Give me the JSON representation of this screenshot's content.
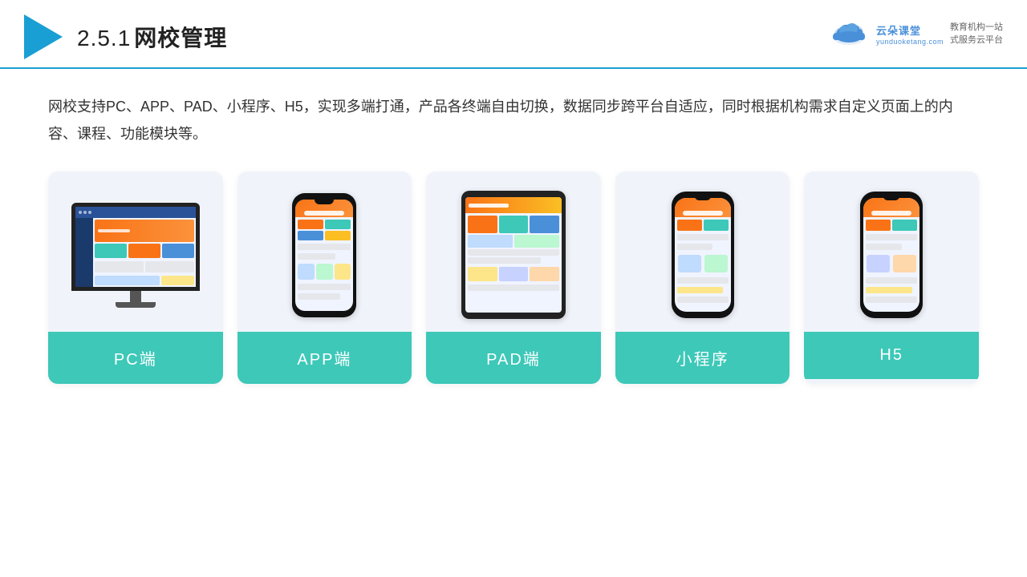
{
  "header": {
    "slide_number": "2.5.1",
    "title": "网校管理"
  },
  "brand": {
    "name": "云朵课堂",
    "url": "yunduoketang.com",
    "slogan_line1": "教育机构一站",
    "slogan_line2": "式服务云平台"
  },
  "description": {
    "text": "网校支持PC、APP、PAD、小程序、H5，实现多端打通，产品各终端自由切换，数据同步跨平台自适应，同时根据机构需求自定义页面上的内容、课程、功能模块等。"
  },
  "cards": [
    {
      "id": "pc",
      "label": "PC端"
    },
    {
      "id": "app",
      "label": "APP端"
    },
    {
      "id": "pad",
      "label": "PAD端"
    },
    {
      "id": "mini-program",
      "label": "小程序"
    },
    {
      "id": "h5",
      "label": "H5"
    }
  ],
  "colors": {
    "accent": "#3dc8b8",
    "header_line": "#1a9fd4",
    "brand_blue": "#4a90d9",
    "triangle": "#1a9fd4"
  }
}
